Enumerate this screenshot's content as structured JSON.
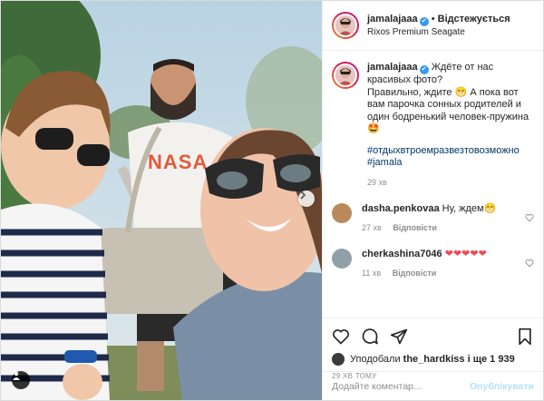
{
  "header": {
    "username": "jamalajaaa",
    "verified_mark": "✔",
    "separator": "•",
    "follow_label": "Відстежується",
    "location": "Rixos Premium Seagate"
  },
  "caption": {
    "username": "jamalajaaa",
    "text_1": "Ждёте от нас красивых фото?",
    "text_2": "Правильно, ждите 😁 А пока вот вам парочка сонных родителей и один бодренький человек-пружина 🤩",
    "hashtags_1": "#отдыхвтроемразвезтовозможно",
    "hashtags_2": "#jamala",
    "time": "29 хв"
  },
  "comments": [
    {
      "username": "dasha.penkovaa",
      "text": "Ну, ждем😁",
      "time": "27 хв",
      "reply": "Відповісти",
      "avatar_color": "#b88a5a"
    },
    {
      "username": "cherkashina7046",
      "text": "❤❤❤❤❤",
      "time": "11 хв",
      "reply": "Відповісти",
      "avatar_color": "#8fa0a8"
    }
  ],
  "actions": {
    "icons": [
      "heart-icon",
      "comment-icon",
      "share-icon",
      "bookmark-icon"
    ],
    "liked_by_prefix": "Уподобали",
    "liked_by_user": "the_hardkiss",
    "liked_by_suffix": "і ще 1 939",
    "time_ago": "29 ХВ ТОМУ"
  },
  "add_comment": {
    "placeholder": "Додайте коментар...",
    "publish_label": "Опублікувати"
  },
  "photo": {
    "shirt_text": "NASA"
  },
  "colors": {
    "link": "#00376b",
    "publish_disabled": "#b2dffc",
    "verified": "#3897f0"
  }
}
